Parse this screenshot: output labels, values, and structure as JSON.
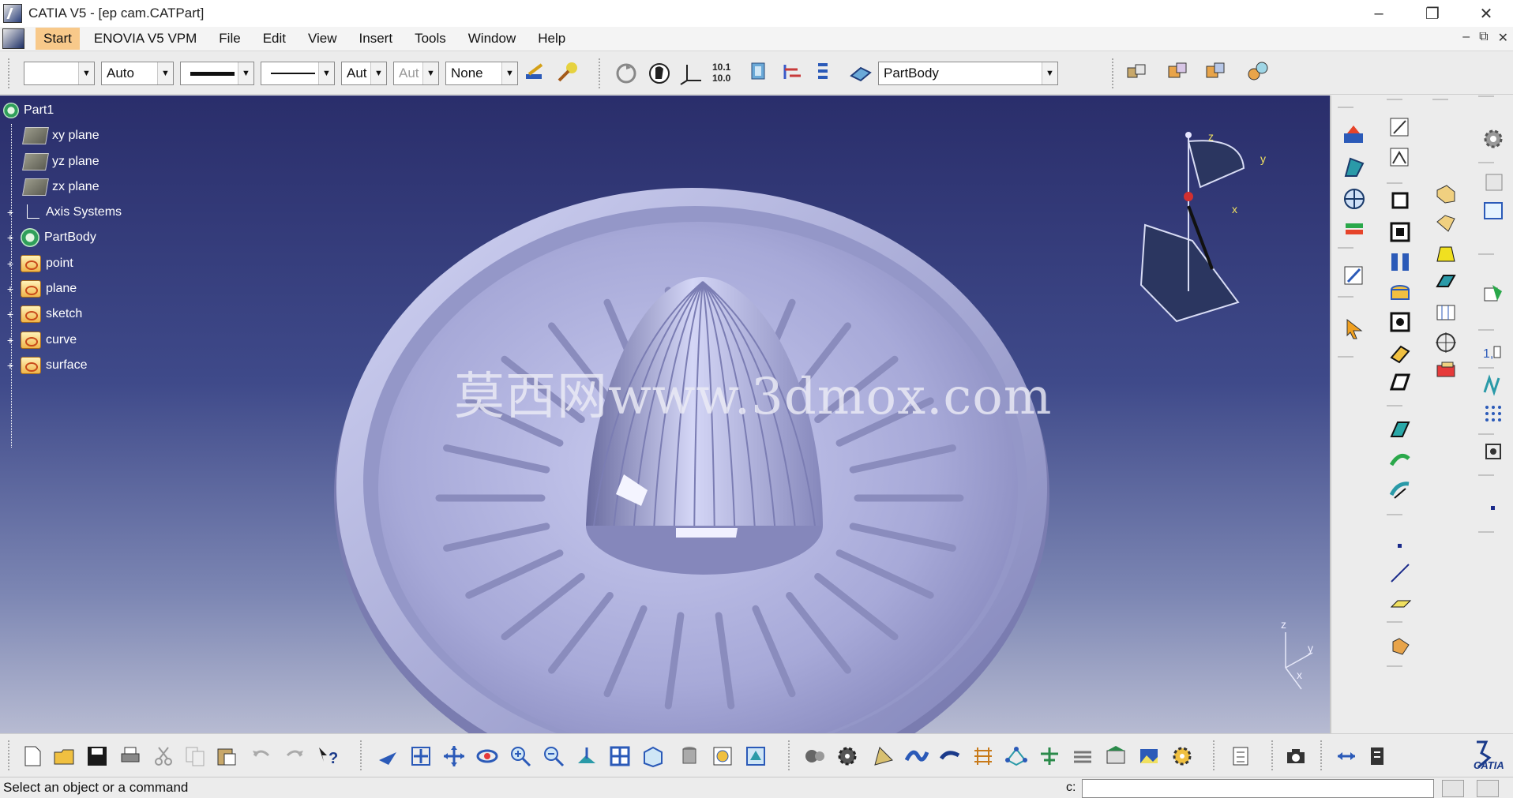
{
  "window": {
    "title": "CATIA V5 - [ep cam.CATPart]",
    "minimize": "–",
    "maximize": "❐",
    "close": "✕"
  },
  "menu": {
    "items": [
      "Start",
      "ENOVIA V5 VPM",
      "File",
      "Edit",
      "View",
      "Insert",
      "Tools",
      "Window",
      "Help"
    ],
    "mdi": [
      "–",
      "⧉",
      "✕"
    ]
  },
  "toolbar": {
    "color_value": "",
    "transparency_value": "Auto",
    "linetype_value": "Aut",
    "layer_value": "Aut",
    "none_value": "None",
    "part_body_value": "PartBody"
  },
  "tree": {
    "root": "Part1",
    "nodes": [
      "xy plane",
      "yz plane",
      "zx plane",
      "Axis Systems",
      "PartBody",
      "point",
      "plane",
      "sketch",
      "curve",
      "surface"
    ]
  },
  "viewport": {
    "watermark": "莫西网www.3dmox.com",
    "compass": {
      "x": "x",
      "y": "y",
      "z": "z"
    },
    "mini_axis": {
      "x": "x",
      "y": "y",
      "z": "z"
    }
  },
  "status": {
    "message": "Select an object or a command",
    "command_label": "c:"
  },
  "brand": {
    "logo_text": "CATIA"
  },
  "colors": {
    "viewport_top": "#2a2e6b",
    "viewport_bottom": "#b7bbd2",
    "part_surface": "#a9abd9",
    "menu_highlight": "#f8c98a"
  }
}
